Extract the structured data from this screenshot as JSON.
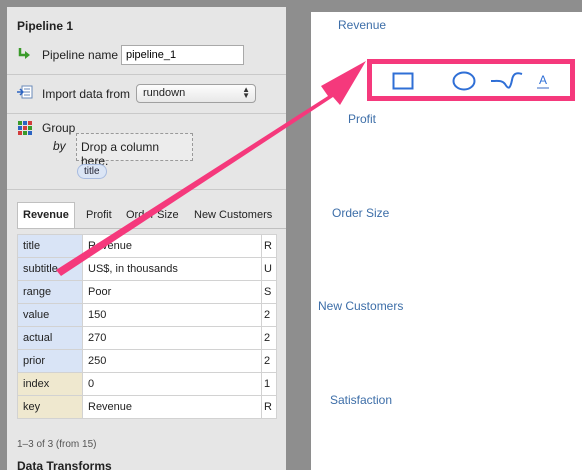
{
  "pipeline": {
    "title": "Pipeline 1",
    "name_label": "Pipeline name",
    "name_value": "pipeline_1",
    "import_label": "Import data from",
    "import_value": "rundown",
    "group_label": "Group",
    "by_label": "by",
    "drop_hint": "Drop a column here.",
    "group_chip": "title"
  },
  "tabs": [
    "Revenue",
    "Profit",
    "Order Size",
    "New Customers"
  ],
  "table": {
    "rows": [
      {
        "key": "title",
        "value": "Revenue",
        "next": "R"
      },
      {
        "key": "subtitle",
        "value": "US$, in thousands",
        "next": "U"
      },
      {
        "key": "range",
        "value": "Poor",
        "next": "S"
      },
      {
        "key": "value",
        "value": "150",
        "next": "2"
      },
      {
        "key": "actual",
        "value": "270",
        "next": "2"
      },
      {
        "key": "prior",
        "value": "250",
        "next": "2"
      },
      {
        "key": "index",
        "value": "0",
        "next": "1"
      },
      {
        "key": "key",
        "value": "Revenue",
        "next": "R"
      }
    ]
  },
  "footer": "1–3 of 3 (from 15)",
  "section_title": "Data Transforms",
  "canvas": {
    "labels": [
      "Revenue",
      "Profit",
      "Order Size",
      "New Customers",
      "Satisfaction"
    ]
  },
  "toolbar": {
    "tools": [
      "rectangle-icon",
      "ellipse-icon",
      "freehand-icon",
      "text-icon"
    ],
    "text_tool_glyph": "A"
  },
  "colors": {
    "highlight": "#f5397c",
    "link": "#3d6ea8"
  }
}
